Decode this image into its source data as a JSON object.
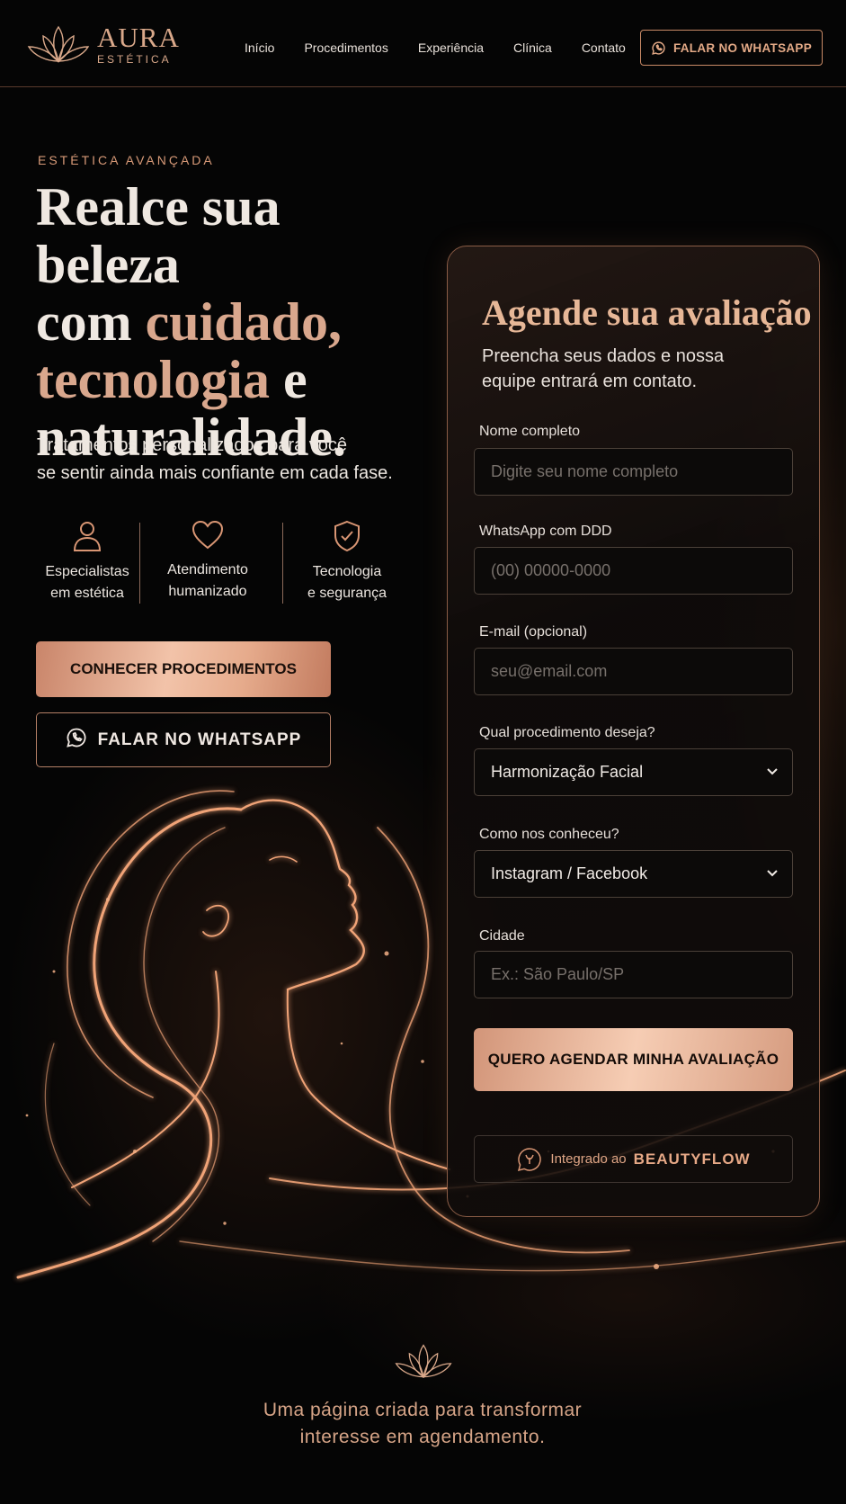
{
  "brand": {
    "name": "AURA",
    "subtitle": "ESTÉTICA"
  },
  "nav": {
    "items": [
      "Início",
      "Procedimentos",
      "Experiência",
      "Clínica",
      "Contato"
    ],
    "cta": "FALAR NO WHATSAPP"
  },
  "hero": {
    "eyebrow": "ESTÉTICA AVANÇADA",
    "title_lines": [
      [
        {
          "text": "Realce sua beleza",
          "accent": false
        }
      ],
      [
        {
          "text": "com ",
          "accent": false
        },
        {
          "text": "cuidado,",
          "accent": true
        }
      ],
      [
        {
          "text": "tecnologia",
          "accent": true
        },
        {
          "text": " e",
          "accent": false
        }
      ],
      [
        {
          "text": "naturalidade.",
          "accent": false
        }
      ]
    ],
    "subtitle_line1": "Tratamentos personalizados para você",
    "subtitle_line2": "se sentir ainda mais confiante em cada fase.",
    "features": [
      {
        "icon": "user-icon",
        "line1": "Especialistas",
        "line2": "em estética"
      },
      {
        "icon": "heart-icon",
        "line1": "Atendimento",
        "line2": "humanizado"
      },
      {
        "icon": "shield-check-icon",
        "line1": "Tecnologia",
        "line2": "e segurança"
      }
    ],
    "primary_button": "CONHECER PROCEDIMENTOS",
    "whatsapp_button": "FALAR NO WHATSAPP"
  },
  "form": {
    "title": "Agende sua avaliação",
    "subtitle_line1": "Preencha seus dados e nossa",
    "subtitle_line2": "equipe entrará em contato.",
    "name_label": "Nome completo",
    "name_placeholder": "Digite seu nome completo",
    "whatsapp_label": "WhatsApp com DDD",
    "whatsapp_placeholder": "(00) 00000-0000",
    "email_label": "E-mail (opcional)",
    "email_placeholder": "seu@email.com",
    "procedure_label": "Qual procedimento deseja?",
    "procedure_value": "Harmonização Facial",
    "source_label": "Como nos conheceu?",
    "source_value": "Instagram / Facebook",
    "city_label": "Cidade",
    "city_placeholder": "Ex.: São Paulo/SP",
    "submit": "QUERO AGENDAR MINHA AVALIAÇÃO",
    "integrated_prefix": "Integrado ao",
    "integrated_brand": "BEAUTYFLOW"
  },
  "footer": {
    "tagline_line1": "Uma página criada para transformar",
    "tagline_line2": "interesse em agendamento."
  },
  "colors": {
    "accent": "#d9a78d",
    "copper": "#c98a66",
    "background": "#050505"
  }
}
